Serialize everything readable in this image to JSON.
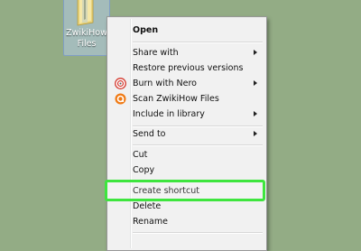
{
  "desktop": {
    "folder": {
      "name_line1": "ZwikiHow",
      "name_line2": "Files",
      "icon": "folder-icon"
    }
  },
  "menu": {
    "items": [
      {
        "label": "Open",
        "bold": true
      },
      {
        "label": "Share with",
        "submenu": true
      },
      {
        "label": "Restore previous versions"
      },
      {
        "label": "Burn with Nero",
        "submenu": true,
        "icon": "nero-icon"
      },
      {
        "label": "Scan ZwikiHow Files",
        "icon": "avast-icon"
      },
      {
        "label": "Include in library",
        "submenu": true
      },
      {
        "label": "Send to",
        "submenu": true
      },
      {
        "label": "Cut"
      },
      {
        "label": "Copy"
      },
      {
        "label": "Create shortcut",
        "highlighted": true
      },
      {
        "label": "Delete"
      },
      {
        "label": "Rename"
      }
    ]
  },
  "colors": {
    "desktop_bg": "#93ac85",
    "highlight": "#3ee53e"
  }
}
